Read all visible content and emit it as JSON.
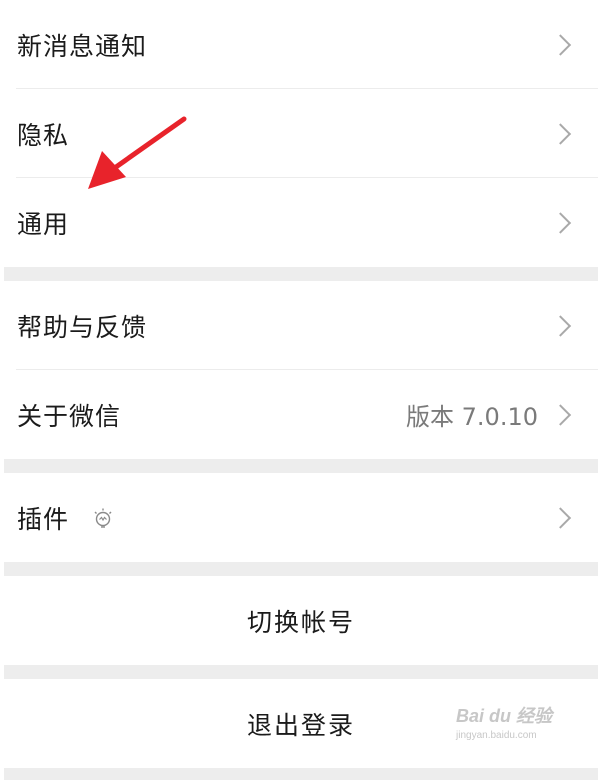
{
  "settings": {
    "items": [
      {
        "label": "新消息通知"
      },
      {
        "label": "隐私"
      },
      {
        "label": "通用"
      },
      {
        "label": "帮助与反馈"
      },
      {
        "label": "关于微信",
        "value": "版本 7.0.10"
      },
      {
        "label": "插件"
      }
    ],
    "switch_account": "切换帐号",
    "logout": "退出登录"
  },
  "watermark": {
    "main": "Bai du 经验",
    "sub": "jingyan.baidu.com"
  },
  "colors": {
    "arrow": "#e8232b",
    "separator": "#ededed",
    "chevron": "#a9a9a9",
    "secondary_text": "#7a7a7a"
  },
  "icons": {
    "chevron": "chevron-right-icon",
    "plugin": "lightbulb-icon",
    "annotation": "red-arrow-icon"
  }
}
